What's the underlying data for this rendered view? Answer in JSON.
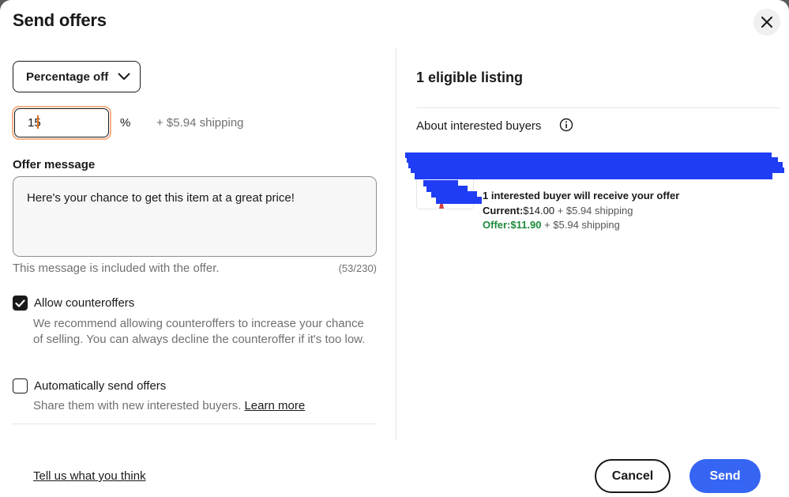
{
  "dialog": {
    "title": "Send offers",
    "close_icon": "close-icon"
  },
  "offer": {
    "type_label": "Percentage off",
    "percentage_value": "15",
    "percent_sign": "%",
    "shipping_note": "+ $5.94 shipping"
  },
  "message": {
    "label": "Offer message",
    "value": "Here's your chance to get this item at a great price!",
    "help": "This message is included with the offer.",
    "count": "(53/230)"
  },
  "counteroffers": {
    "checked": true,
    "label": "Allow counteroffers",
    "description": "We recommend allowing counteroffers to increase your chance of selling. You can always decline the counteroffer if it's too low."
  },
  "auto_send": {
    "checked": false,
    "label": "Automatically send offers",
    "description": "Share them with new interested buyers.",
    "link": "Learn more"
  },
  "listings": {
    "heading": "1 eligible listing",
    "about_label": "About interested buyers",
    "info_icon": "info-icon",
    "item": {
      "buyers_line": "1 interested buyer will receive your offer",
      "current_label": "Current:",
      "current_price": "$14.00",
      "current_shipping": "+ $5.94 shipping",
      "offer_label": "Offer:",
      "offer_price": "$11.90",
      "offer_shipping": "+ $5.94 shipping"
    }
  },
  "footer": {
    "feedback_link": "Tell us what you think",
    "cancel_label": "Cancel",
    "send_label": "Send"
  },
  "colors": {
    "primary": "#3665f3",
    "offer_green": "#1a8a3c",
    "focus_ring": "#f6b088",
    "redaction": "#1f3df4"
  }
}
